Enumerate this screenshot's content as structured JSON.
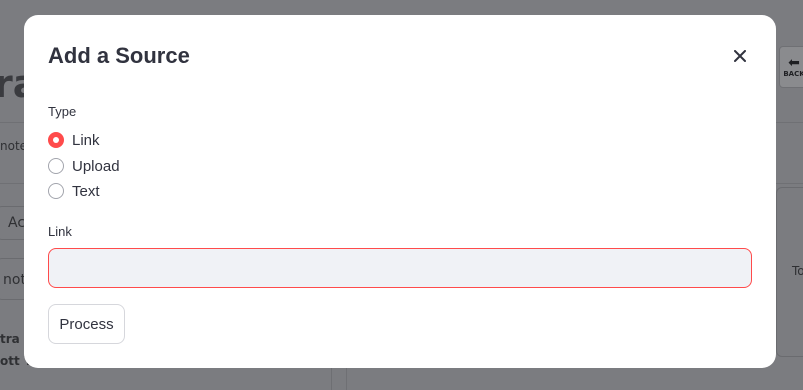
{
  "background": {
    "title_fragment": "ra",
    "notes_fragment": "note",
    "tab_fragment": "Ac",
    "item_fragment": "not",
    "name_fragment_1": "tra L",
    "name_fragment_2": "ott Y",
    "right_fragment": "To",
    "back_button_label": "BACK"
  },
  "modal": {
    "title": "Add a Source",
    "close_symbol": "×",
    "type_label": "Type",
    "type_options": [
      {
        "label": "Link",
        "selected": true
      },
      {
        "label": "Upload",
        "selected": false
      },
      {
        "label": "Text",
        "selected": false
      }
    ],
    "link_label": "Link",
    "link_value": "",
    "link_placeholder": "",
    "process_label": "Process"
  },
  "colors": {
    "accent": "#ff4b4b",
    "text": "#31333f",
    "input_bg": "#f0f2f6",
    "overlay": "#7b7c80"
  }
}
